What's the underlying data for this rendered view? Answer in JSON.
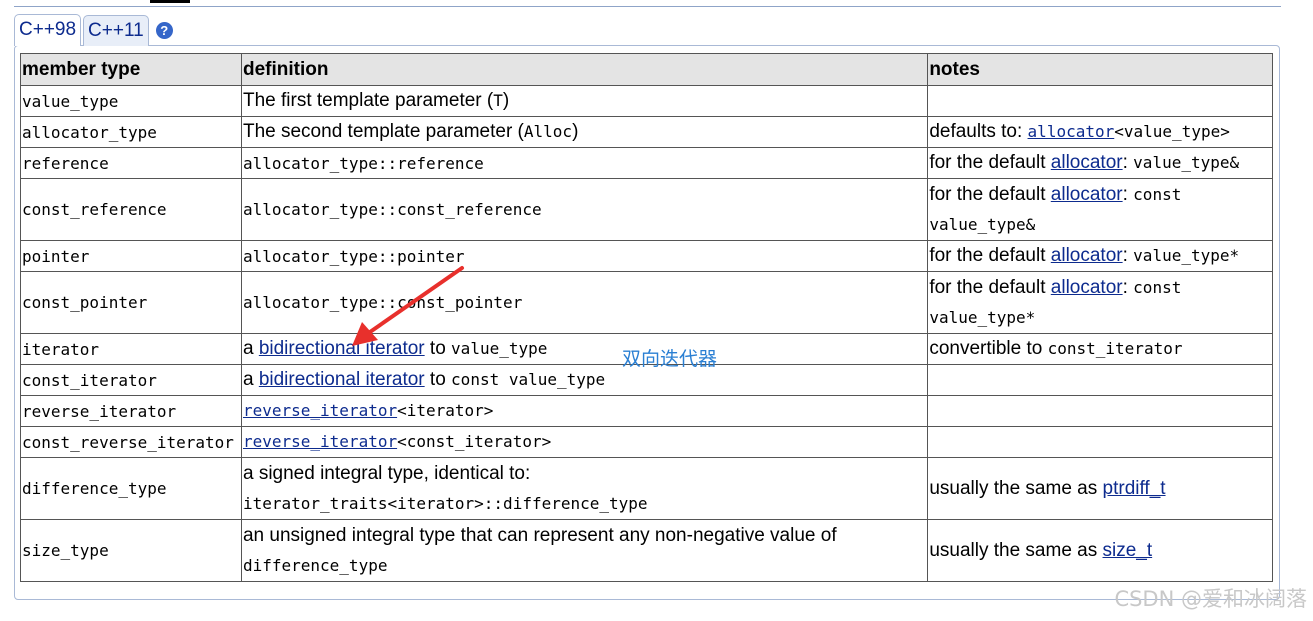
{
  "tabs": [
    {
      "label": "C++98",
      "active": true
    },
    {
      "label": "C++11",
      "active": false
    }
  ],
  "help_icon": "question-mark-icon",
  "table": {
    "headers": [
      "member type",
      "definition",
      "notes"
    ],
    "rows": [
      {
        "name": "value_type",
        "def_text": "The first template parameter (",
        "def_code": "T",
        "def_tail": ")"
      },
      {
        "name": "allocator_type",
        "def_text": "The second template parameter (",
        "def_code": "Alloc",
        "def_tail": ")",
        "note_text": "defaults to: ",
        "note_link": "allocator",
        "note_code": "<value_type>"
      },
      {
        "name": "reference",
        "def_code": "allocator_type::reference",
        "note_text": "for the default ",
        "note_link": "allocator",
        "note_sep": ": ",
        "note_code": "value_type&"
      },
      {
        "name": "const_reference",
        "def_code": "allocator_type::const_reference",
        "note_text": "for the default ",
        "note_link": "allocator",
        "note_sep": ": ",
        "note_code_a": "const",
        "note_code_b": "value_type&"
      },
      {
        "name": "pointer",
        "def_code": "allocator_type::pointer",
        "note_text": "for the default ",
        "note_link": "allocator",
        "note_sep": ": ",
        "note_code": "value_type*"
      },
      {
        "name": "const_pointer",
        "def_code": "allocator_type::const_pointer",
        "note_text": "for the default ",
        "note_link": "allocator",
        "note_sep": ": ",
        "note_code_a": "const",
        "note_code_b": "value_type*"
      },
      {
        "name": "iterator",
        "def_pre": "a ",
        "def_link": "bidirectional iterator",
        "def_mid": " to ",
        "def_code": "value_type",
        "note_text": "convertible to ",
        "note_code": "const_iterator"
      },
      {
        "name": "const_iterator",
        "def_pre": "a ",
        "def_link": "bidirectional iterator",
        "def_mid": " to ",
        "def_code": "const value_type"
      },
      {
        "name": "reverse_iterator",
        "def_link": "reverse_iterator",
        "def_code": "<iterator>"
      },
      {
        "name": "const_reverse_iterator",
        "def_link": "reverse_iterator",
        "def_code": "<const_iterator>"
      },
      {
        "name": "difference_type",
        "def_text": "a signed integral type, identical to:",
        "def_code": "iterator_traits<iterator>::difference_type",
        "note_text": "usually the same as ",
        "note_link": "ptrdiff_t"
      },
      {
        "name": "size_type",
        "def_text": "an unsigned integral type that can represent any non-negative value of",
        "def_code": "difference_type",
        "note_text": "usually the same as ",
        "note_link": "size_t"
      }
    ]
  },
  "annotation": {
    "text": "双向迭代器",
    "color": "#2a7fd3",
    "arrow_color": "#e8302c"
  },
  "watermark": "CSDN @爱和冰阔落",
  "colors": {
    "link": "#0d2b8e",
    "header_bg": "#e4e4e4",
    "tab_border": "#a9b9d6"
  }
}
